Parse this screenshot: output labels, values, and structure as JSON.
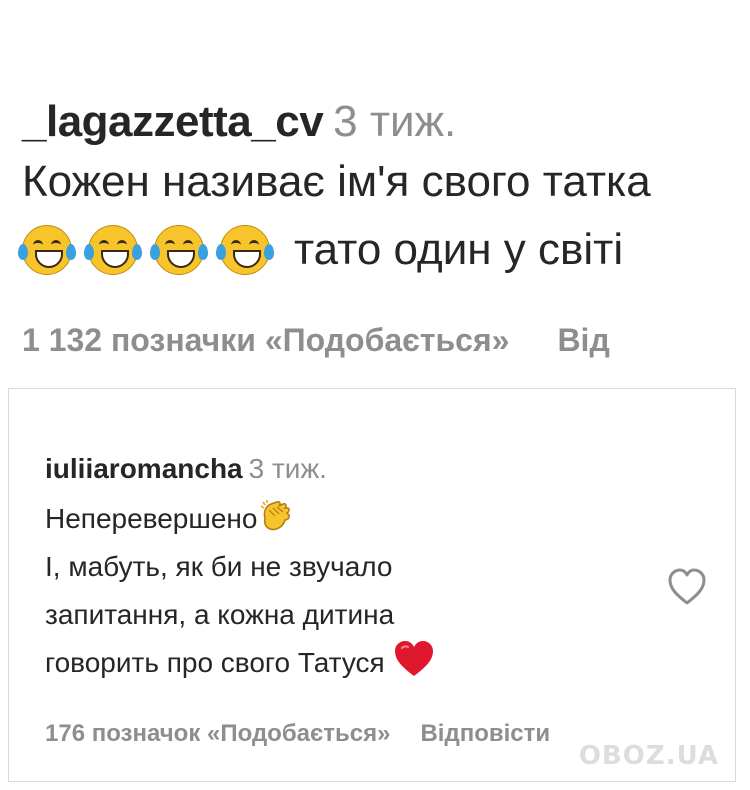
{
  "comment1": {
    "username": "_lagazzetta_cv",
    "time": "3 тиж.",
    "text_line1": "Кожен називає ім'я свого татка",
    "emoji": "face-with-tears-of-joy",
    "text_line2_after_emoji": "тато один у світі",
    "likes_text": "1 132 позначки «Подобається»",
    "reply_text": "Від"
  },
  "comment2": {
    "username": "iuliiaromancha",
    "time": "3 тиж.",
    "line1": "Неперевершено",
    "line1_emoji": "clapping-hands",
    "line2": "І, мабуть, як би не звучало",
    "line3": "запитання, а кожна дитина",
    "line4": "говорить про свого Татуся",
    "line4_emoji": "red-heart",
    "likes_text": "176 позначок «Подобається»",
    "reply_text": "Відповісти",
    "like_icon": "heart-outline-icon"
  },
  "watermark": "OBOZ.UA",
  "colors": {
    "text": "#262626",
    "muted": "#8e8e8e",
    "heart_red": "#e0182d",
    "emoji_yellow": "#f8c42c"
  }
}
